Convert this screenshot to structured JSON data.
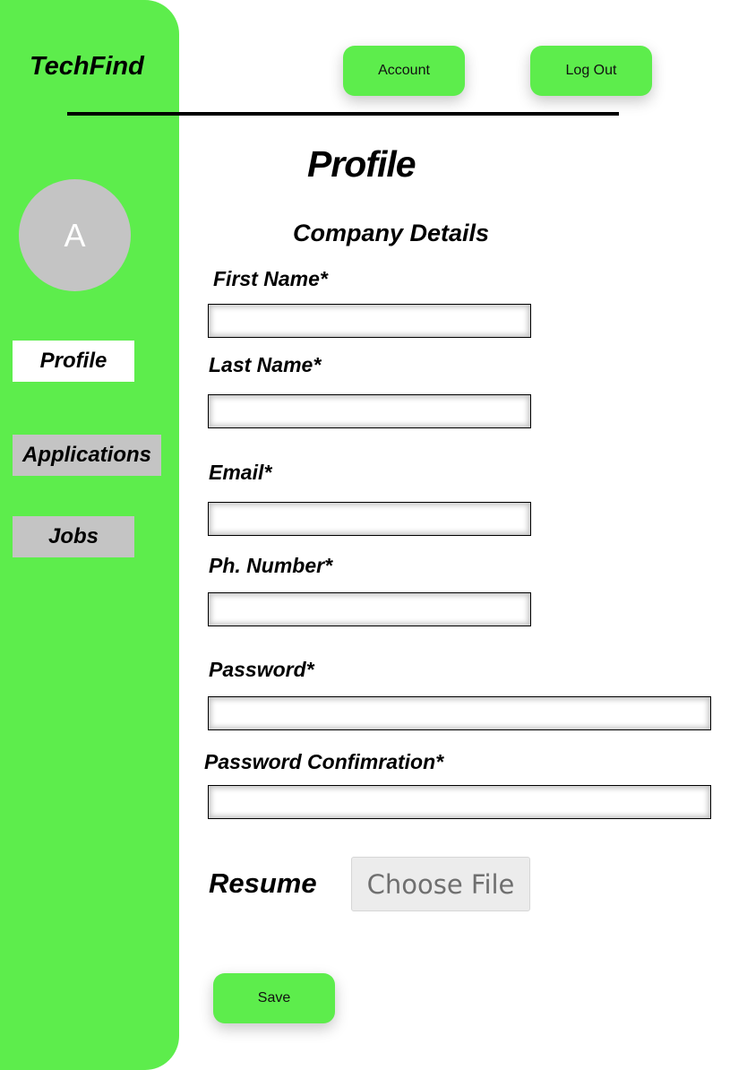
{
  "app": {
    "title": "TechFind"
  },
  "sidebar": {
    "avatar_initial": "A",
    "items": [
      {
        "label": "Profile",
        "active": true
      },
      {
        "label": "Applications",
        "active": false
      },
      {
        "label": "Jobs",
        "active": false
      }
    ]
  },
  "header": {
    "account_label": "Account",
    "logout_label": "Log Out"
  },
  "main": {
    "page_title": "Profile",
    "section_title": "Company Details",
    "fields": {
      "first_name": {
        "label": "First Name*",
        "value": ""
      },
      "last_name": {
        "label": "Last Name*",
        "value": ""
      },
      "email": {
        "label": "Email*",
        "value": ""
      },
      "phone": {
        "label": "Ph.  Number*",
        "value": ""
      },
      "password": {
        "label": "Password*",
        "value": ""
      },
      "password_confirmation": {
        "label": "Password Confimration*",
        "value": ""
      }
    },
    "resume": {
      "label": "Resume",
      "button_label": "Choose File"
    },
    "save_label": "Save"
  },
  "colors": {
    "accent": "#5ded4c",
    "nav_inactive": "#c4c4c4",
    "avatar_bg": "#c4c4c4"
  }
}
